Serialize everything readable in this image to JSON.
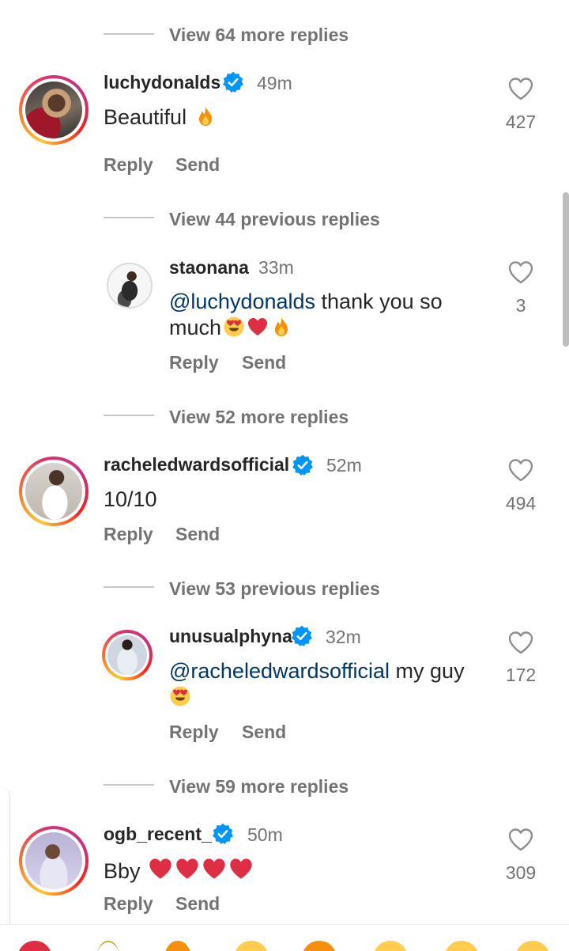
{
  "threads": [
    {
      "view_more": "View 64 more replies",
      "comment": {
        "username": "luchydonalds",
        "verified": true,
        "time": "49m",
        "text": "Beautiful",
        "emojis": [
          "fire"
        ],
        "likes": "427",
        "reply_label": "Reply",
        "send_label": "Send"
      },
      "view_previous": "View 44 previous replies",
      "reply": {
        "username": "staonana",
        "verified": false,
        "time": "33m",
        "mention": "@luchydonalds",
        "text_line1": " thank you so",
        "text_line2": "much",
        "emojis": [
          "heart-eyes",
          "red-heart",
          "fire"
        ],
        "likes": "3",
        "reply_label": "Reply",
        "send_label": "Send"
      }
    },
    {
      "view_more": "View 52 more replies",
      "comment": {
        "username": "racheledwardsofficial",
        "verified": true,
        "time": "52m",
        "text": "10/10",
        "likes": "494",
        "reply_label": "Reply",
        "send_label": "Send"
      },
      "view_previous": "View 53 previous replies",
      "reply": {
        "username": "unusualphyna",
        "verified": true,
        "time": "32m",
        "mention": "@racheledwardsofficial",
        "text_line1": " my guy",
        "emojis": [
          "heart-eyes"
        ],
        "likes": "172",
        "reply_label": "Reply",
        "send_label": "Send"
      }
    },
    {
      "view_more": "View 59 more replies",
      "comment": {
        "username": "ogb_recent_",
        "verified": true,
        "time": "50m",
        "text": "Bby",
        "emojis": [
          "red-heart",
          "red-heart",
          "red-heart",
          "red-heart"
        ],
        "likes": "309",
        "reply_label": "Reply",
        "send_label": "Send"
      }
    }
  ],
  "colors": {
    "text": "#262626",
    "secondary": "#737373",
    "mention": "#00376b",
    "verified": "#0095f6",
    "heart_emoji": "#e0245e"
  },
  "emoji_bar": [
    "red-heart",
    "clapping-hands",
    "fire",
    "raising-hands",
    "crying-face",
    "heart-eyes",
    "smiling-face",
    "grinning-face"
  ]
}
